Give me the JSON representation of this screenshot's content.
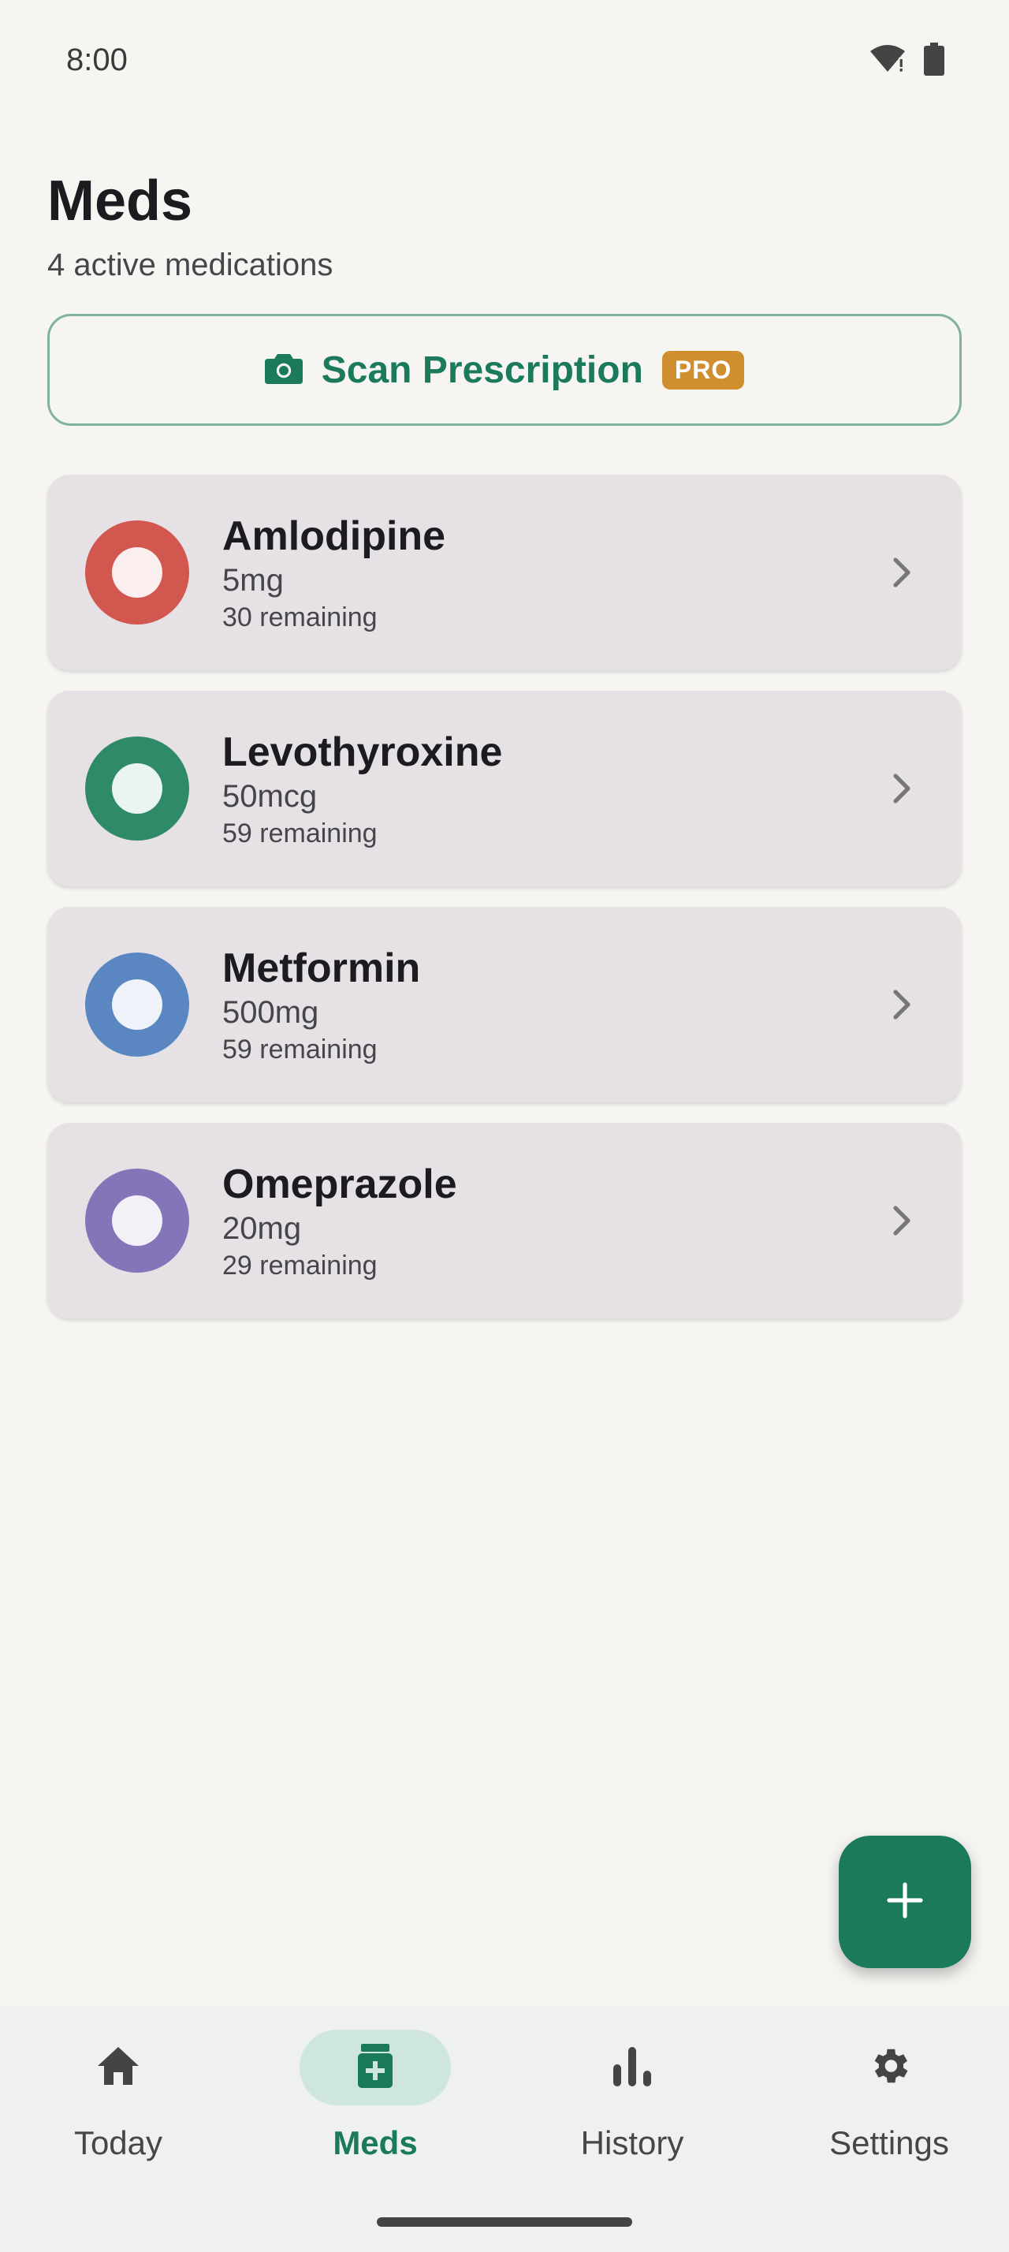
{
  "status_bar": {
    "time": "8:00",
    "icons": [
      "wifi-icon",
      "battery-icon"
    ]
  },
  "header": {
    "title": "Meds",
    "subtitle": "4 active medications"
  },
  "scan": {
    "label": "Scan Prescription",
    "badge": "PRO",
    "icon": "camera-icon"
  },
  "meds": [
    {
      "name": "Amlodipine",
      "dose": "5mg",
      "remaining": "30 remaining",
      "color": "#d2574f"
    },
    {
      "name": "Levothyroxine",
      "dose": "50mcg",
      "remaining": "59 remaining",
      "color": "#2f8a67"
    },
    {
      "name": "Metformin",
      "dose": "500mg",
      "remaining": "59 remaining",
      "color": "#5a86c2"
    },
    {
      "name": "Omeprazole",
      "dose": "20mg",
      "remaining": "29 remaining",
      "color": "#8574b8"
    }
  ],
  "fab": {
    "icon": "plus-icon"
  },
  "nav": {
    "items": [
      {
        "label": "Today",
        "icon": "home-icon",
        "active": false
      },
      {
        "label": "Meds",
        "icon": "pill-bottle-icon",
        "active": true
      },
      {
        "label": "History",
        "icon": "bar-chart-icon",
        "active": false
      },
      {
        "label": "Settings",
        "icon": "gear-icon",
        "active": false
      }
    ]
  },
  "colors": {
    "accent": "#1c7a5c",
    "pro": "#d08f2e",
    "card": "#e6e1e5",
    "background": "#f6f5f2"
  }
}
